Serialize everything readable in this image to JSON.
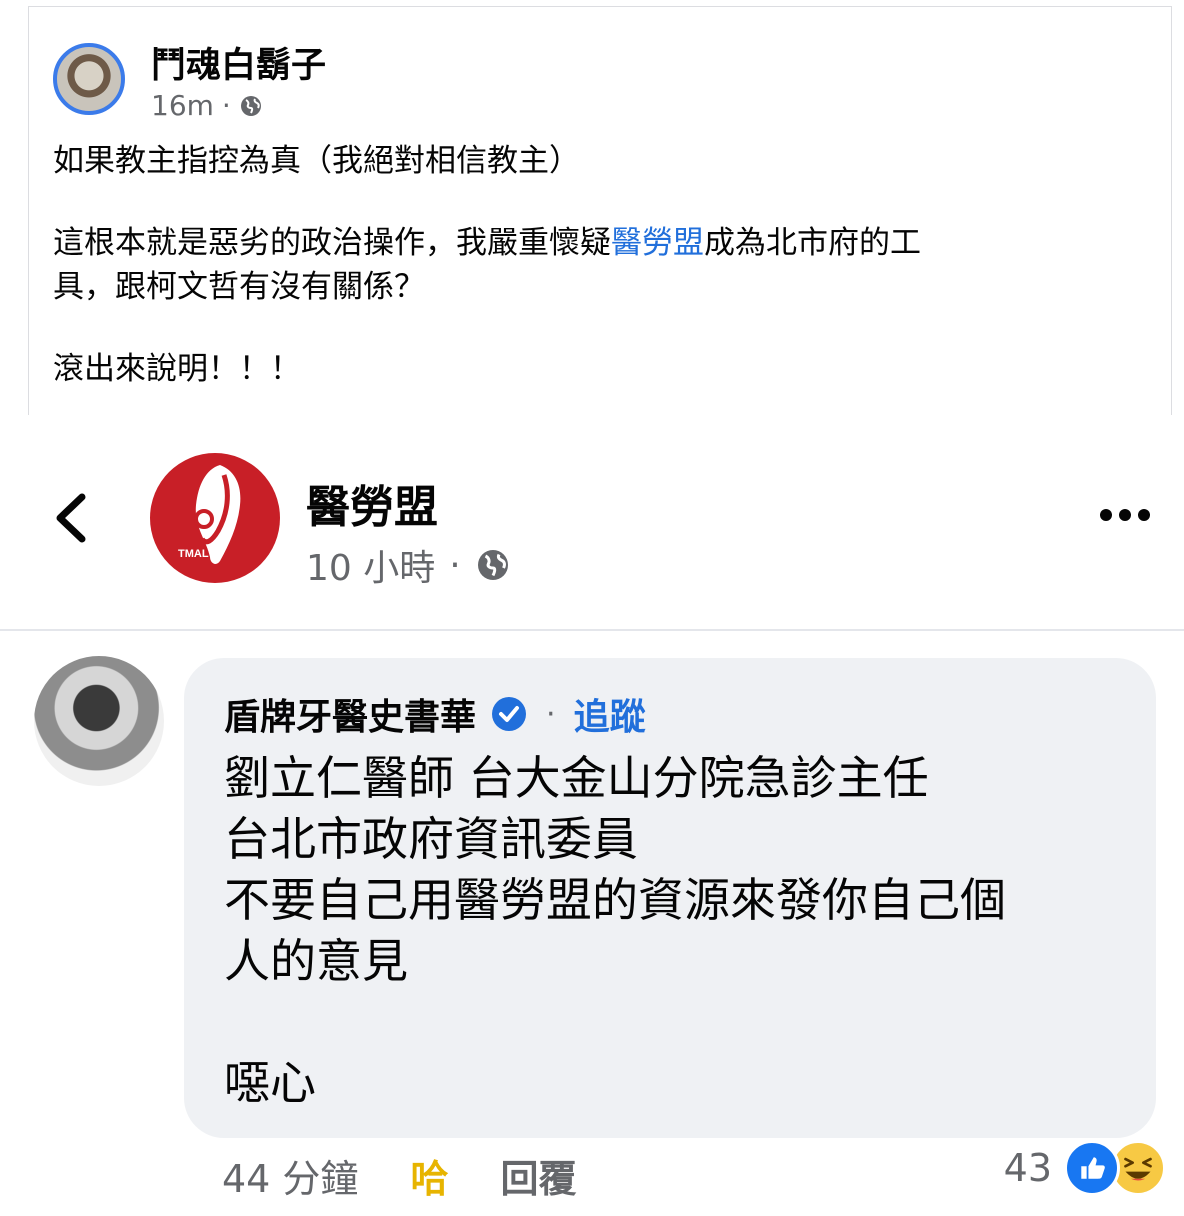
{
  "post": {
    "author": "鬥魂白鬍子",
    "time": "16m",
    "meta_separator": "·",
    "lines": [
      "如果教主指控為真（我絕對相信教主）",
      "這根本就是惡劣的政治操作，我嚴重懷疑",
      "醫勞盟",
      "成為北市府的工",
      "具，跟柯文哲有沒有關係？",
      "滾出來說明！！！"
    ]
  },
  "page": {
    "name": "醫勞盟",
    "time": "10 小時",
    "meta_separator": "·",
    "logo_text": "TMAL",
    "brand_color": "#c81f27"
  },
  "comment": {
    "author": "盾牌牙醫史書華",
    "separator": "·",
    "follow_label": "追蹤",
    "lines": [
      "劉立仁醫師 台大金山分院急診主任",
      "台北市政府資訊委員",
      "不要自己用醫勞盟的資源來發你自己個",
      "人的意見",
      "噁心"
    ],
    "time": "44 分鐘",
    "reaction_label": "哈",
    "reply_label": "回覆",
    "reaction_count": "43",
    "reactions": [
      "like-icon",
      "haha-icon"
    ]
  },
  "colors": {
    "link": "#216fdb",
    "laugh": "#e7b400",
    "bubble": "#eff1f4"
  }
}
